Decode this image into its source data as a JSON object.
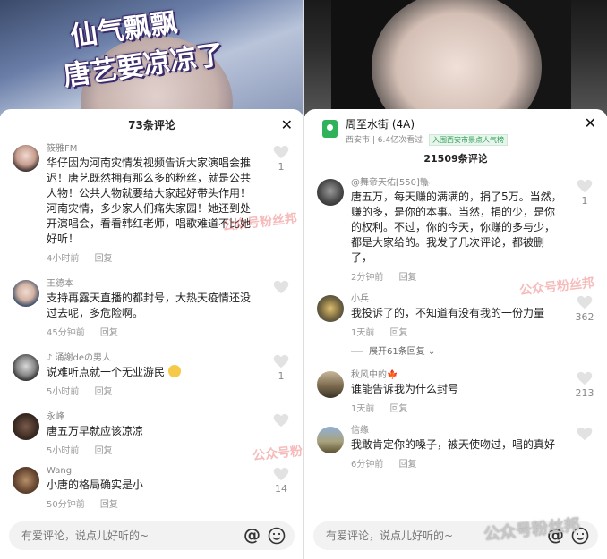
{
  "left": {
    "overlay_line1": "仙气飘飘",
    "overlay_line2": "唐艺要凉凉了",
    "header_title": "73条评论",
    "comments": [
      {
        "user": "筱雅FM",
        "text": "华仔因为河南灾情发视频告诉大家演唱会推迟！唐艺既然拥有那么多的粉丝，就是公共人物！公共人物就要给大家起好带头作用！河南灾情，多少家人们痛失家园！她还到处开演唱会，看看韩红老师，唱歌难道不比她好听！",
        "time": "4小时前",
        "reply": "回复",
        "likes": "1"
      },
      {
        "user": "王德本",
        "text": "支持再露天直播的都封号，大热天疫情还没过去呢，多危险啊。",
        "time": "45分钟前",
        "reply": "回复",
        "likes": ""
      },
      {
        "user": "♪ 涌謝deの男人",
        "text": "说难听点就一个无业游民",
        "time": "5小时前",
        "reply": "回复",
        "likes": "1"
      },
      {
        "user": "永峰",
        "text": "唐五万早就应该凉凉",
        "time": "5小时前",
        "reply": "回复",
        "likes": ""
      },
      {
        "user": "Wang",
        "text": "小唐的格局确实是小",
        "time": "50分钟前",
        "reply": "回复",
        "likes": "14"
      }
    ],
    "input_placeholder": "有爱评论，说点儿好听的~"
  },
  "right": {
    "location": {
      "title": "周至水街 (4A)",
      "city": "西安市",
      "views": "6.4亿次看过",
      "badge": "入围西安市景点人气榜"
    },
    "header_title": "21509条评论",
    "comments": [
      {
        "user": "@舞帝天佑[550]🐘",
        "text": "唐五万，每天赚的满满的，捐了5万。当然，赚的多，是你的本事。当然，捐的少，是你的权利。不过，你的今天，你赚的多与少，都是大家给的。我发了几次评论，都被删了，",
        "time": "2分钟前",
        "reply": "回复",
        "likes": "1"
      },
      {
        "user": "小兵",
        "text": "我投诉了的，不知道有没有我的一份力量",
        "time": "1天前",
        "reply": "回复",
        "likes": "362"
      },
      {
        "user": "秋风中的🍁",
        "text": "谁能告诉我为什么封号",
        "time": "1天前",
        "reply": "回复",
        "likes": "213"
      },
      {
        "user": "信缘",
        "text": "我敢肯定你的嗓子，被天使吻过，唱的真好",
        "time": "6分钟前",
        "reply": "回复",
        "likes": ""
      }
    ],
    "expand_text": "展开61条回复",
    "input_placeholder": "有爱评论，说点儿好听的~"
  },
  "watermark": "公众号粉丝邦",
  "colors": {
    "accent_green": "#2fb25a",
    "text_gray": "#999999"
  },
  "icons": {
    "close": "close-icon",
    "like": "heart-icon",
    "mention": "at-icon",
    "emoji": "smiley-icon",
    "location": "location-pin-icon"
  }
}
